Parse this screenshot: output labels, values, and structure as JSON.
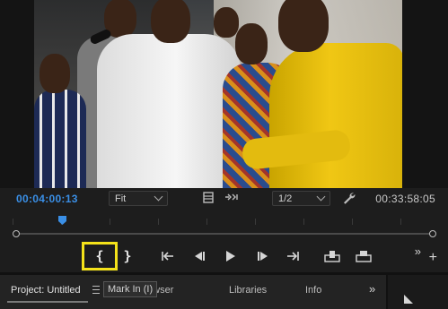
{
  "monitor": {
    "current_timecode": "00:04:00:13",
    "zoom_value": "Fit",
    "resolution_value": "1/2",
    "duration_timecode": "00:33:58:05"
  },
  "transport": {
    "mark_in_label": "{",
    "mark_out_label": "}",
    "more_label": "»",
    "add_label": "+"
  },
  "tooltip": {
    "text": "Mark In (I)"
  },
  "tabs": {
    "project": "Project: Untitled",
    "media_browser": "Media Browser",
    "libraries": "Libraries",
    "info": "Info",
    "more_label": "»"
  },
  "colors": {
    "timecode_accent": "#3a8fe6",
    "highlight_box": "#f4e21a"
  }
}
